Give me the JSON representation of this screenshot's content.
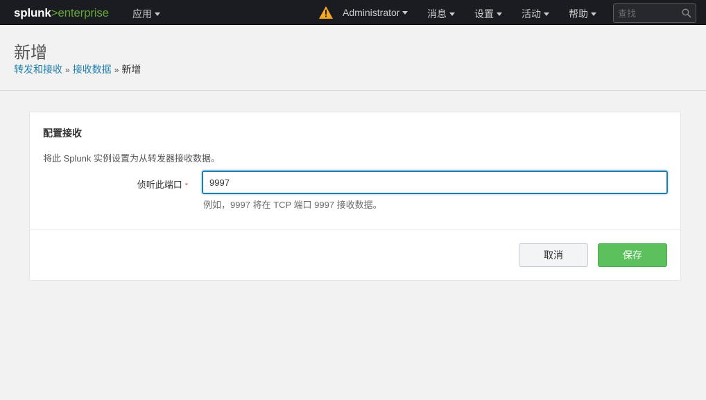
{
  "topbar": {
    "logo_main": "splunk",
    "logo_accent": ">enterprise",
    "apps": "应用",
    "user": "Administrator",
    "messages": "消息",
    "settings": "设置",
    "activity": "活动",
    "help": "帮助",
    "search_placeholder": "查找",
    "warning_color": "#f5a623",
    "icons": [
      "warning-icon",
      "search-icon",
      "caret-down-icon"
    ]
  },
  "header": {
    "title": "新增",
    "breadcrumb": {
      "item1": "转发和接收",
      "item2": "接收数据",
      "separator": "»",
      "current": "新增"
    }
  },
  "panel": {
    "title": "配置接收",
    "description": "将此 Splunk 实例设置为从转发器接收数据。",
    "field_label": "侦听此端口",
    "required_mark": "*",
    "field_value": "9997",
    "field_help": "例如，9997 将在 TCP 端口 9997 接收数据。",
    "cancel_label": "取消",
    "save_label": "保存"
  }
}
